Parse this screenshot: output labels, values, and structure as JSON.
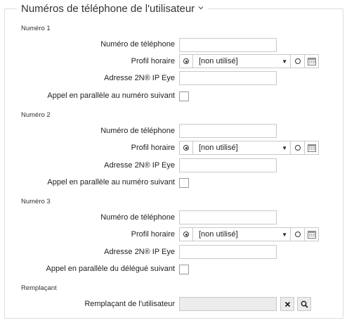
{
  "panel": {
    "title": "Numéros de téléphone de l'utilisateur",
    "collapse_icon": "chevron-down-icon"
  },
  "sections": [
    {
      "label": "Numéro 1",
      "phone_label": "Numéro de téléphone",
      "phone_value": "",
      "profile_label": "Profil horaire",
      "profile_value": "[non utilisé]",
      "eye_label": "Adresse 2N® IP Eye",
      "eye_value": "",
      "parallel_label": "Appel en parallèle au numéro suivant",
      "parallel_checked": false
    },
    {
      "label": "Numéro 2",
      "phone_label": "Numéro de téléphone",
      "phone_value": "",
      "profile_label": "Profil horaire",
      "profile_value": "[non utilisé]",
      "eye_label": "Adresse 2N® IP Eye",
      "eye_value": "",
      "parallel_label": "Appel en parallèle au numéro suivant",
      "parallel_checked": false
    },
    {
      "label": "Numéro 3",
      "phone_label": "Numéro de téléphone",
      "phone_value": "",
      "profile_label": "Profil horaire",
      "profile_value": "[non utilisé]",
      "eye_label": "Adresse 2N® IP Eye",
      "eye_value": "",
      "parallel_label": "Appel en parallèle du délégué suivant",
      "parallel_checked": false
    }
  ],
  "substitute": {
    "section_label": "Remplaçant",
    "field_label": "Remplaçant de l'utilisateur",
    "value": "",
    "clear_icon": "close-icon",
    "search_icon": "search-icon"
  },
  "icons": {
    "radio": "radio-icon",
    "calendar": "calendar-icon"
  }
}
